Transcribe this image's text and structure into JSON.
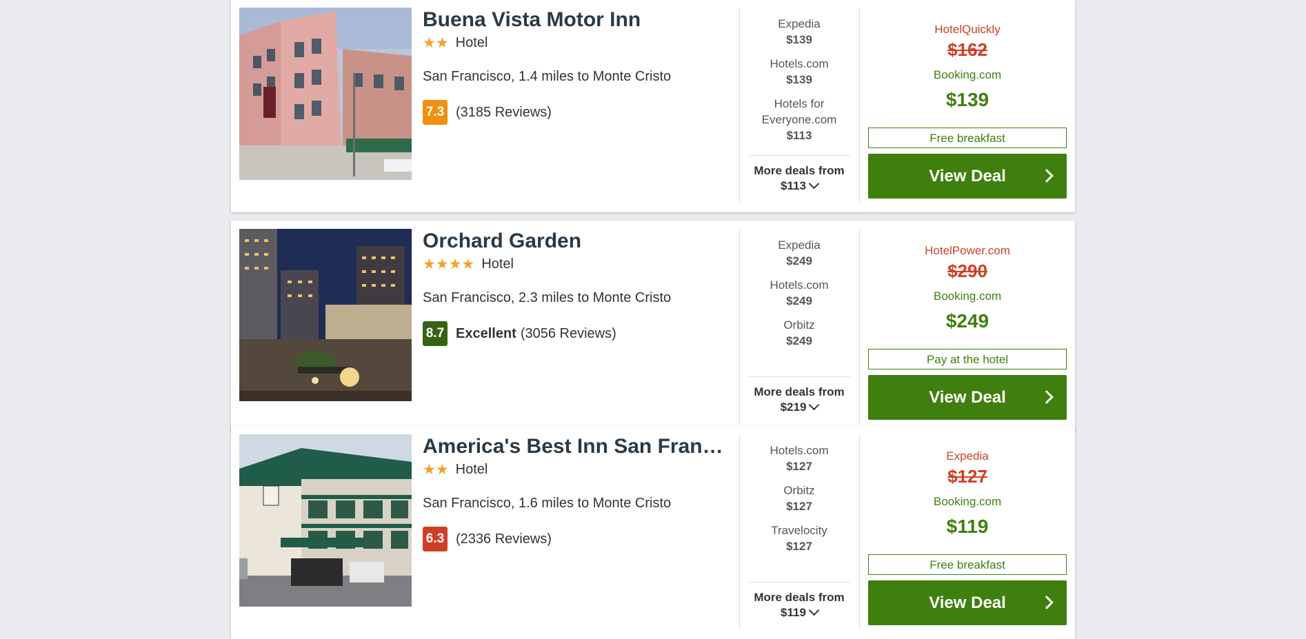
{
  "colors": {
    "accent_green": "#3f7f0d",
    "strike_red": "#cf3f25",
    "star_orange": "#f4a12c",
    "score_orange": "#f08f10",
    "score_green": "#356314",
    "score_red": "#cf3f25"
  },
  "hotels": [
    {
      "name": "Buena Vista Motor Inn",
      "stars": "★★",
      "star_count": 2,
      "type": "Hotel",
      "location": "San Francisco, 1.4 miles to Monte Cristo",
      "score": "7.3",
      "rating_word": "",
      "reviews": "(3185 Reviews)",
      "deals": [
        {
          "site": "Expedia",
          "price": "$139"
        },
        {
          "site": "Hotels.com",
          "price": "$139"
        },
        {
          "site": "Hotels for Everyone.com",
          "price": "$113"
        }
      ],
      "more_label": "More deals from",
      "more_price": "$113",
      "strike_site": "HotelQuickly",
      "strike_price": "$162",
      "best_site": "Booking.com",
      "best_price": "$139",
      "perk": "Free breakfast",
      "button": "View Deal",
      "image_icon": "pink-building-photo"
    },
    {
      "name": "Orchard Garden",
      "stars": "★★★★",
      "star_count": 4,
      "type": "Hotel",
      "location": "San Francisco, 2.3 miles to Monte Cristo",
      "score": "8.7",
      "rating_word": "Excellent",
      "reviews": "(3056 Reviews)",
      "deals": [
        {
          "site": "Expedia",
          "price": "$249"
        },
        {
          "site": "Hotels.com",
          "price": "$249"
        },
        {
          "site": "Orbitz",
          "price": "$249"
        }
      ],
      "more_label": "More deals from",
      "more_price": "$219",
      "strike_site": "HotelPower.com",
      "strike_price": "$290",
      "best_site": "Booking.com",
      "best_price": "$249",
      "perk": "Pay at the hotel",
      "button": "View Deal",
      "image_icon": "night-rooftop-photo"
    },
    {
      "name": "America's Best Inn San Francisco",
      "stars": "★★",
      "star_count": 2,
      "type": "Hotel",
      "location": "San Francisco, 1.6 miles to Monte Cristo",
      "score": "6.3",
      "rating_word": "",
      "reviews": "(2336 Reviews)",
      "deals": [
        {
          "site": "Hotels.com",
          "price": "$127"
        },
        {
          "site": "Orbitz",
          "price": "$127"
        },
        {
          "site": "Travelocity",
          "price": "$127"
        }
      ],
      "more_label": "More deals from",
      "more_price": "$119",
      "strike_site": "Expedia",
      "strike_price": "$127",
      "best_site": "Booking.com",
      "best_price": "$119",
      "perk": "Free breakfast",
      "button": "View Deal",
      "image_icon": "motel-photo"
    }
  ]
}
